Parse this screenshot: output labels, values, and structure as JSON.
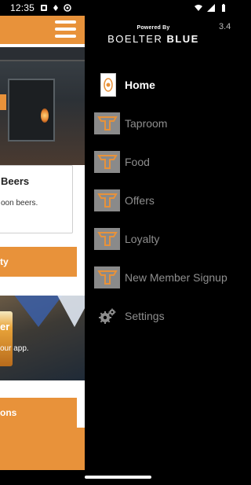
{
  "status_bar": {
    "time": "12:35"
  },
  "app_background": {
    "card": {
      "title_fragment": "Beers",
      "subtitle_fragment": "oon beers."
    },
    "loyalty_button_fragment": "ty",
    "promo": {
      "title_fragment": "er",
      "subtitle_fragment": "our app."
    },
    "locations_button_fragment": "ons",
    "colors": {
      "accent": "#e8923a"
    }
  },
  "drawer": {
    "powered_by": "Powered By",
    "brand": {
      "name_light": "BOELTER",
      "name_bold": "BLUE"
    },
    "version": "3.4",
    "menu": [
      {
        "label": "Home",
        "icon": "home-logo-icon",
        "active": true
      },
      {
        "label": "Taproom",
        "icon": "brand-logo-icon",
        "active": false
      },
      {
        "label": "Food",
        "icon": "brand-logo-icon",
        "active": false
      },
      {
        "label": "Offers",
        "icon": "brand-logo-icon",
        "active": false
      },
      {
        "label": "Loyalty",
        "icon": "brand-logo-icon",
        "active": false
      },
      {
        "label": "New Member Signup",
        "icon": "brand-logo-icon",
        "active": false
      },
      {
        "label": "Settings",
        "icon": "gear-icon",
        "active": false
      }
    ],
    "colors": {
      "background": "#000000",
      "active_text": "#ffffff",
      "inactive_text": "#8e8e8e"
    }
  }
}
